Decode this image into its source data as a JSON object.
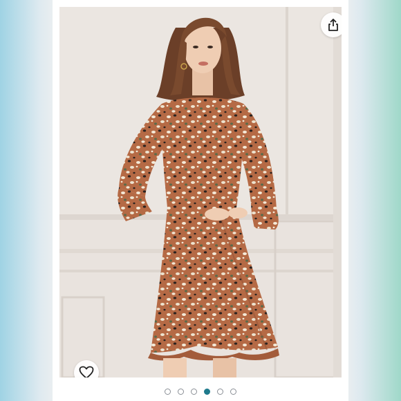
{
  "listing": {
    "image": {
      "subject": "woman-in-rust-floral-ruffle-dress",
      "background_color": "#e9e3de",
      "dress_color": "#b56a45"
    },
    "share_icon": "share-icon",
    "like_icon": "heart-outline-icon"
  },
  "carousel": {
    "total": 6,
    "active_index": 3,
    "active_color": "#1f7a8c"
  }
}
